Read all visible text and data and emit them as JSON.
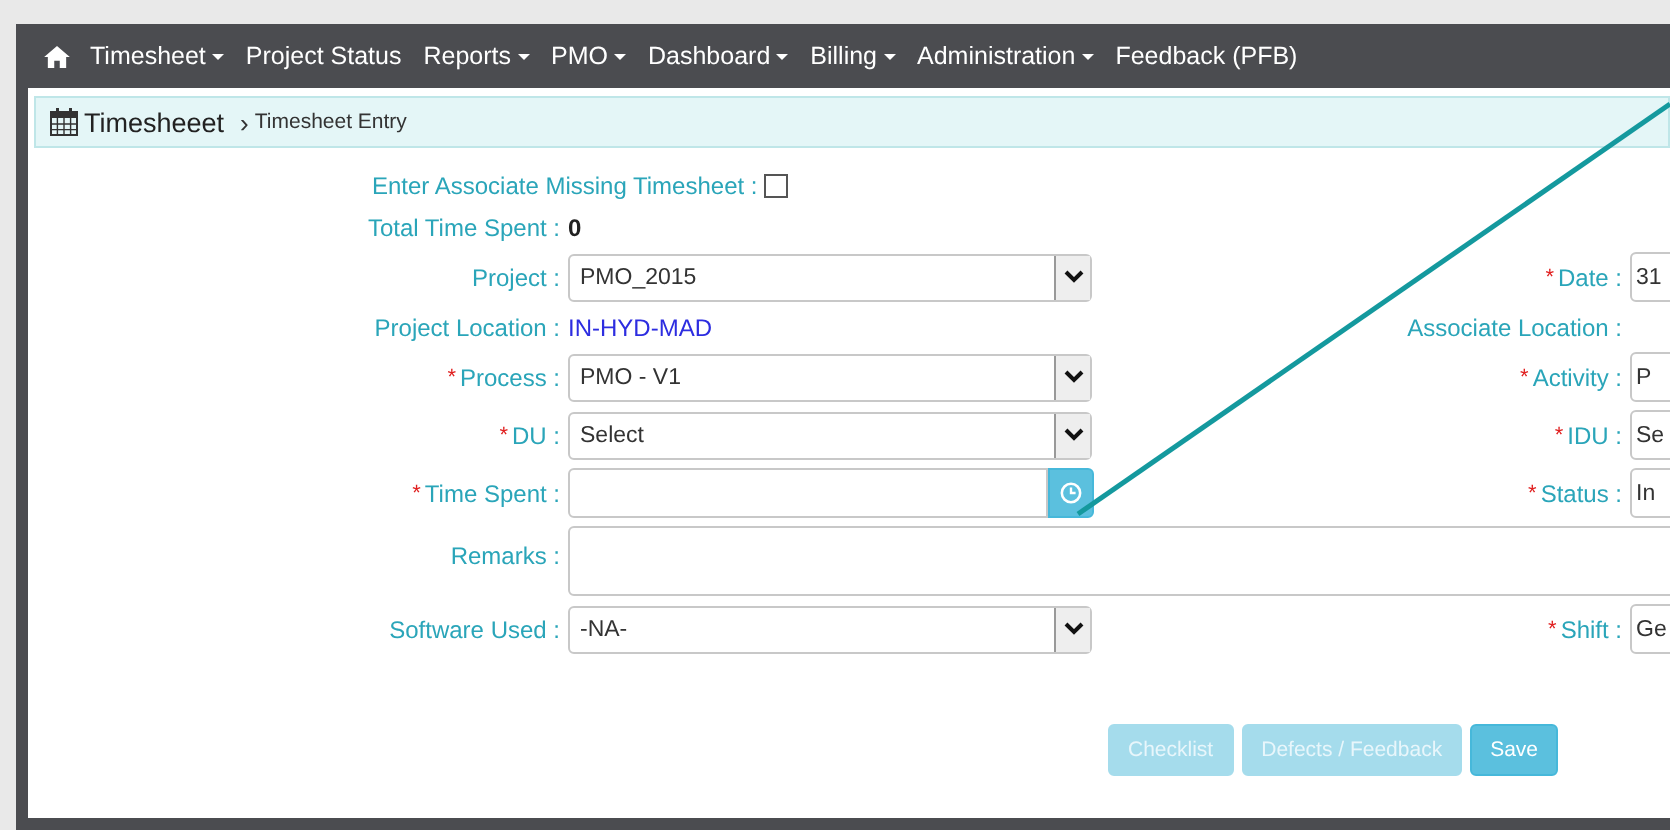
{
  "nav": {
    "items": [
      {
        "label": "Timesheet",
        "dropdown": true
      },
      {
        "label": "Project Status",
        "dropdown": false
      },
      {
        "label": "Reports",
        "dropdown": true
      },
      {
        "label": "PMO",
        "dropdown": true
      },
      {
        "label": "Dashboard",
        "dropdown": true
      },
      {
        "label": "Billing",
        "dropdown": true
      },
      {
        "label": "Administration",
        "dropdown": true
      },
      {
        "label": "Feedback (PFB)",
        "dropdown": false
      }
    ]
  },
  "breadcrumb": {
    "title": "Timesheeet",
    "separator": "›",
    "current": "Timesheet Entry"
  },
  "form": {
    "rows": [
      {
        "left": {
          "kind": "checkbox",
          "label": "Enter Associate Missing Timesheet :",
          "checked": false
        }
      },
      {
        "left": {
          "kind": "count",
          "label": "Total Time Spent :",
          "value": "0"
        }
      },
      {
        "left": {
          "kind": "select",
          "label": "Project :",
          "value": "PMO_2015"
        },
        "right": {
          "kind": "input",
          "label": "Date :",
          "required_mark": "*",
          "value": "31"
        }
      },
      {
        "left": {
          "kind": "info",
          "label": "Project Location :",
          "value": "IN-HYD-MAD"
        },
        "right": {
          "kind": "label",
          "label": "Associate Location :"
        }
      },
      {
        "left": {
          "kind": "select",
          "label": "Process :",
          "required_mark": "*",
          "value": "PMO - V1"
        },
        "right": {
          "kind": "input",
          "label": "Activity :",
          "required_mark": "*",
          "value": "P"
        }
      },
      {
        "left": {
          "kind": "select",
          "label": "DU :",
          "required_mark": "*",
          "value": "Select"
        },
        "right": {
          "kind": "input",
          "label": "IDU :",
          "required_mark": "*",
          "value": "Se"
        }
      },
      {
        "left": {
          "kind": "time",
          "label": "Time Spent :",
          "required_mark": "*"
        },
        "right": {
          "kind": "input",
          "label": "Status :",
          "required_mark": "*",
          "value": "In"
        }
      },
      {
        "left": {
          "kind": "textarea",
          "label": "Remarks :"
        }
      },
      {
        "left": {
          "kind": "select",
          "label": "Software Used :",
          "value": "-NA-"
        },
        "right": {
          "kind": "input",
          "label": "Shift :",
          "required_mark": "*",
          "value": "Ge"
        }
      }
    ]
  },
  "buttons": [
    {
      "label": "Checklist",
      "disabled": true
    },
    {
      "label": "Defects / Feedback",
      "disabled": true
    },
    {
      "label": "Save",
      "disabled": false
    }
  ]
}
